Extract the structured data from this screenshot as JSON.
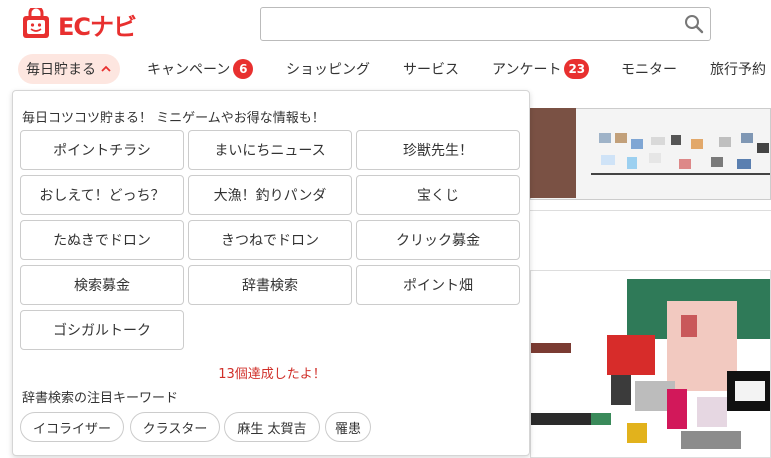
{
  "header": {
    "logo_text": "ECナビ",
    "search": {
      "value": "",
      "placeholder": ""
    },
    "colors": {
      "brand": "#e8302f"
    }
  },
  "nav": {
    "items": [
      {
        "label": "毎日貯まる",
        "active": true
      },
      {
        "label": "キャンペーン",
        "badge": "6"
      },
      {
        "label": "ショッピング"
      },
      {
        "label": "サービス"
      },
      {
        "label": "アンケート",
        "badge": "23"
      },
      {
        "label": "モニター"
      },
      {
        "label": "旅行予約"
      }
    ]
  },
  "dropdown": {
    "heading": "毎日コツコツ貯まる！ ミニゲームやお得な情報も！",
    "buttons": [
      "ポイントチラシ",
      "まいにちニュース",
      "珍獣先生！",
      "おしえて！どっち？",
      "大漁！釣りパンダ",
      "宝くじ",
      "たぬきでドロン",
      "きつねでドロン",
      "クリック募金",
      "検索募金",
      "辞書検索",
      "ポイント畑",
      "ゴシガルトーク"
    ],
    "achievement": "13個達成したよ！",
    "keyword_title": "辞書検索の注目キーワード",
    "keywords": [
      "イコライザー",
      "クラスター",
      "麻生 太賀吉",
      "罹患"
    ]
  }
}
